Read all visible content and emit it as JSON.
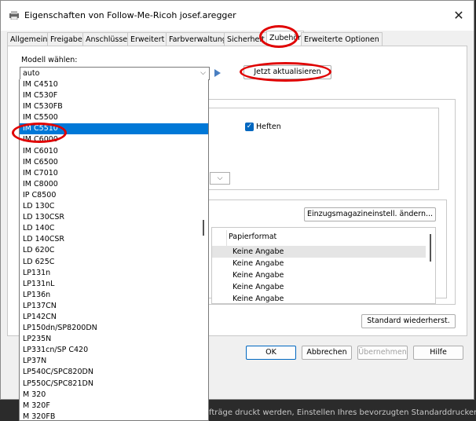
{
  "window": {
    "title": "Eigenschaften von Follow-Me-Ricoh josef.aregger",
    "close_glyph": "✕"
  },
  "tabs": [
    {
      "label": "Allgemein"
    },
    {
      "label": "Freigabe"
    },
    {
      "label": "Anschlüsse"
    },
    {
      "label": "Erweitert"
    },
    {
      "label": "Farbverwaltung"
    },
    {
      "label": "Sicherheit"
    },
    {
      "label": "Zubehör"
    },
    {
      "label": "Erweiterte Optionen"
    }
  ],
  "model": {
    "label": "Modell wählen:",
    "value": "auto",
    "chevron": "⌵",
    "update_button": "Jetzt aktualisieren"
  },
  "model_list": [
    "IM C4510",
    "IM C530F",
    "IM C530FB",
    "IM C5500",
    "IM C5510",
    "IM C6000",
    "IM C6010",
    "IM C6500",
    "IM C7010",
    "IM C8000",
    "IP C8500",
    "LD 130C",
    "LD 130CSR",
    "LD 140C",
    "LD 140CSR",
    "LD 620C",
    "LD 625C",
    "LP131n",
    "LP131nL",
    "LP136n",
    "LP137CN",
    "LP142CN",
    "LP150dn/SP8200DN",
    "LP235N",
    "LP331cn/SP C420",
    "LP37N",
    "LP540C/SPC820DN",
    "LP550C/SPC821DN",
    "M 320",
    "M 320F",
    "M 320FB"
  ],
  "selected_index": 4,
  "options": {
    "staple_label": "Heften",
    "staple_checked": true,
    "tray_settings_button": "Einzugsmagazineinstell. ändern...",
    "paper_format_header": "Papierformat",
    "paper_rows": [
      "Keine Angabe",
      "Keine Angabe",
      "Keine Angabe",
      "Keine Angabe",
      "Keine Angabe"
    ],
    "restore_defaults_button": "Standard wiederherst."
  },
  "footer": {
    "ok": "OK",
    "cancel": "Abbrechen",
    "apply": "Übernehmen",
    "help": "Hilfe"
  },
  "background_text": "fträge druckt werden, Einstellen Ihres bevorzugten Standarddruckers",
  "colors": {
    "accent": "#0078d7",
    "highlight": "#e00000"
  }
}
